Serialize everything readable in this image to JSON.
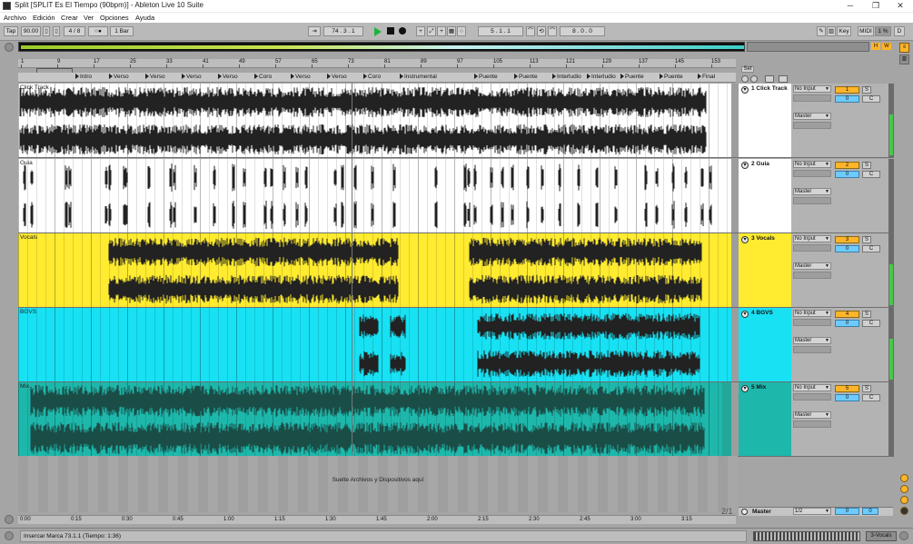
{
  "window": {
    "title": "Split  [SPLIT Es El Tiempo (90bpm)] - Ableton Live 10 Suite"
  },
  "menu": [
    "Archivo",
    "Edición",
    "Crear",
    "Ver",
    "Opciones",
    "Ayuda"
  ],
  "transport": {
    "tap": "Tap",
    "tempo": "90.00",
    "signature": "4 / 8",
    "metronome": "○●",
    "quantize": "1 Bar",
    "position": "74 .   3 .   1",
    "loop_start": "5 .   1 .   1",
    "loop_length": "8 .   0 .   0",
    "key": "Key",
    "midi": "MIDI",
    "cpu": "1 %",
    "disk": "D",
    "overview_marker_h": "H",
    "overview_marker_w": "W"
  },
  "ruler": {
    "bars": [
      "1",
      "9",
      "17",
      "25",
      "33",
      "41",
      "49",
      "57",
      "65",
      "73",
      "81",
      "89",
      "97",
      "105",
      "113",
      "121",
      "129",
      "137",
      "145",
      "153"
    ]
  },
  "locators": [
    "Intro",
    "Verso",
    "Verso",
    "Verso",
    "Verso",
    "Coro",
    "Verso",
    "Verso",
    "Coro",
    "Instrumental",
    "Puente",
    "Puente",
    "Interludio",
    "Interludio",
    "Puente",
    "Puente",
    "Final"
  ],
  "set_button": "Set",
  "tracks": [
    {
      "lane_label": "Click Track",
      "header": "1 Click Track",
      "number": "1",
      "input": "No Input",
      "output": "Master",
      "solo": "S",
      "volume": "0",
      "pan": "C",
      "color": "#ffffff",
      "header_color": "#ffffff"
    },
    {
      "lane_label": "Guia",
      "header": "2 Guia",
      "number": "2",
      "input": "No Input",
      "output": "Master",
      "solo": "S",
      "volume": "0",
      "pan": "C",
      "color": "#ffffff",
      "header_color": "#ffffff"
    },
    {
      "lane_label": "Vocals",
      "header": "3 Vocals",
      "number": "3",
      "input": "No Input",
      "output": "Master",
      "solo": "S",
      "volume": "0",
      "pan": "C",
      "color": "#ffeb2f",
      "header_color": "#ffeb2f"
    },
    {
      "lane_label": "BGVS",
      "header": "4 BGVS",
      "number": "4",
      "input": "No Input",
      "output": "Master",
      "solo": "S",
      "volume": "0",
      "pan": "C",
      "color": "#17e1f3",
      "header_color": "#17e1f3"
    },
    {
      "lane_label": "Mix",
      "header": "5 Mix",
      "number": "5",
      "input": "No Input",
      "output": "Master",
      "solo": "S",
      "volume": "0",
      "pan": "C",
      "color": "#1db8ab",
      "header_color": "#1db8ab"
    }
  ],
  "drop_area_text": "Suelte Archivos y Dispositivos aquí",
  "fraction": "2/1",
  "master": {
    "name": "Master",
    "output": "1/2",
    "volume": "0",
    "pan": "0"
  },
  "time_ruler": [
    "0:00",
    "0:15",
    "0:30",
    "0:45",
    "1:00",
    "1:15",
    "1:30",
    "1:45",
    "2:00",
    "2:15",
    "2:30",
    "2:45",
    "3:00",
    "3:15"
  ],
  "status_text": "Insercar Marca 73.1.1 (Tiempo: 1:36)",
  "focused_track": "3-Vocals"
}
